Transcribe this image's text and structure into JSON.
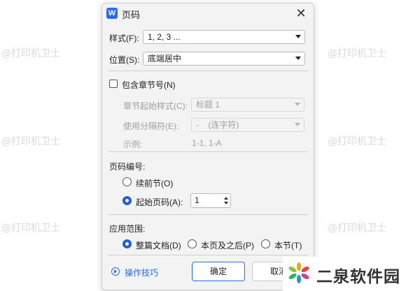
{
  "watermark": "@打印机卫士",
  "dialog": {
    "title": "页码",
    "app_icon": "W",
    "close_label": "✕"
  },
  "style": {
    "label": "样式(F):",
    "value": "1, 2, 3 ..."
  },
  "position": {
    "label": "位置(S):",
    "value": "底端居中"
  },
  "include_chapter": {
    "label": "包含章节号(N)",
    "checked": false,
    "chapter_style_label": "章节起始样式(C):",
    "chapter_style_value": "标题 1",
    "separator_label": "使用分隔符(E):",
    "separator_value": "-    (连字符)",
    "example_label": "示例:",
    "example_value": "1-1, 1-A"
  },
  "numbering": {
    "section_label": "页码编号:",
    "continue_label": "续前节(O)",
    "start_label": "起始页码(A):",
    "start_value": "1"
  },
  "apply": {
    "section_label": "应用范围:",
    "options": [
      "整篇文档(D)",
      "本页及之后(P)",
      "本节(T)"
    ],
    "selected": 0
  },
  "footer": {
    "help_label": "操作技巧",
    "ok_label": "确定",
    "cancel_label": "取消"
  },
  "brand": {
    "text": "二泉软件园"
  },
  "colors": {
    "accent": "#2a6cf0",
    "dialog_bg": "#f3f3f3"
  }
}
